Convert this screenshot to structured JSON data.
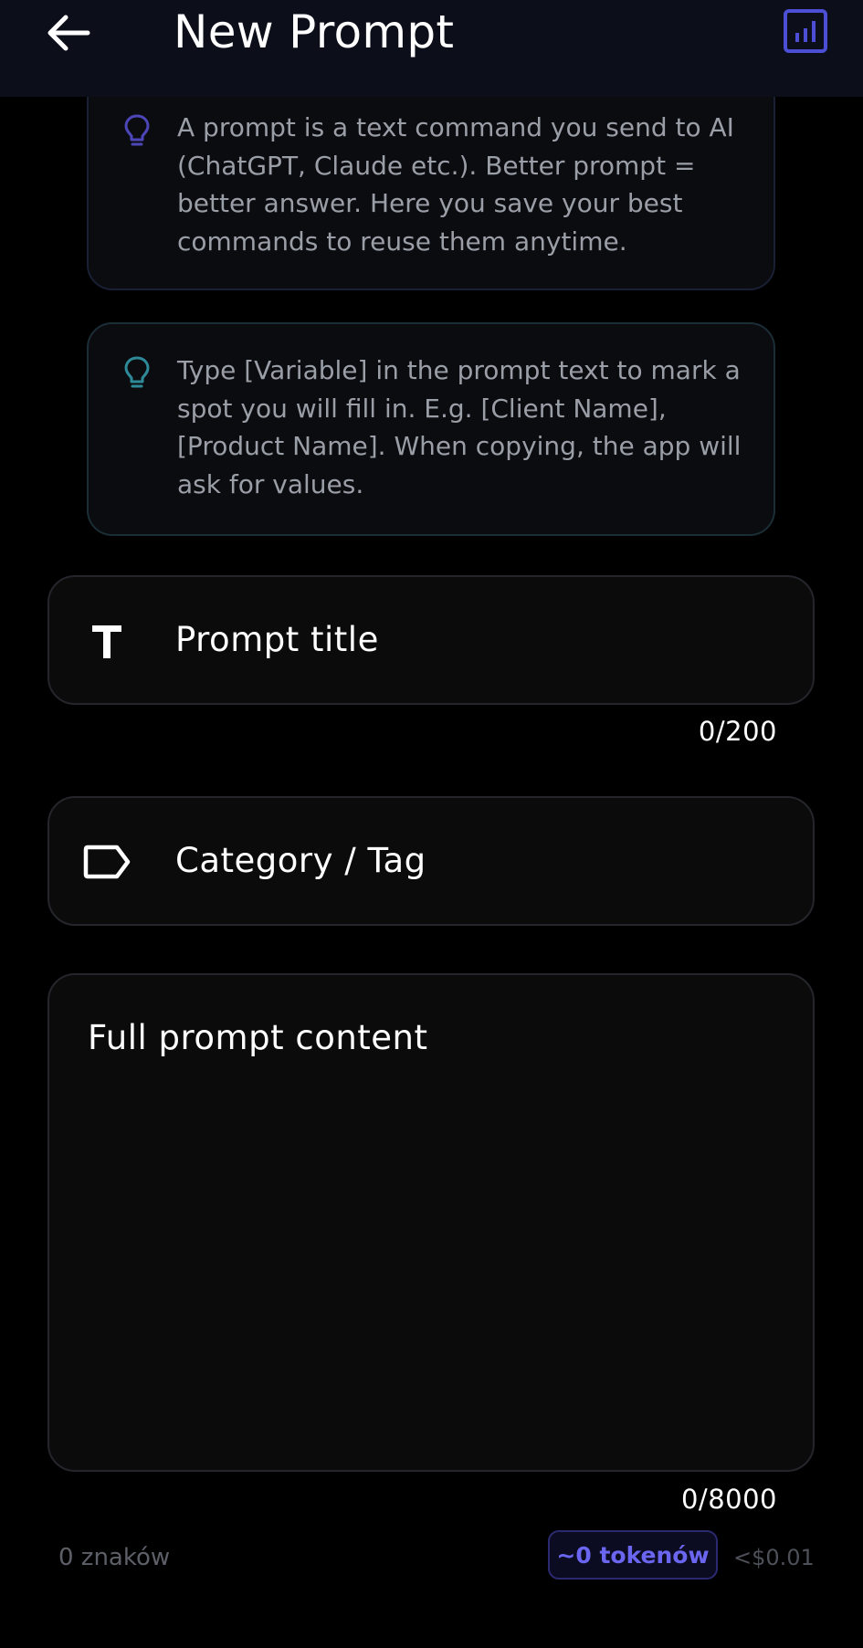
{
  "header": {
    "title": "New Prompt",
    "back_icon": "arrow-left-icon",
    "stats_icon": "bar-chart-icon",
    "accent_color": "#4c4fd6"
  },
  "info_cards": [
    {
      "icon": "lightbulb-icon",
      "icon_color": "#4d46b8",
      "text": "A prompt is a text command you send to AI (ChatGPT, Claude etc.). Better prompt = better answer. Here you save your best commands to reuse them anytime."
    },
    {
      "icon": "lightbulb-icon",
      "icon_color": "#2e8a98",
      "text": "Type [Variable] in the prompt text to mark a spot you will fill in. E.g. [Client Name], [Product Name]. When copying, the app will ask for values."
    }
  ],
  "form": {
    "title_field": {
      "icon": "text-t-icon",
      "placeholder": "Prompt title",
      "value": "",
      "counter": "0/200"
    },
    "category_field": {
      "icon": "tag-icon",
      "placeholder": "Category / Tag",
      "value": ""
    },
    "content_field": {
      "placeholder": "Full prompt content",
      "value": "",
      "counter": "0/8000"
    }
  },
  "stats": {
    "chars": "0 znaków",
    "tokens": "~0 tokenów",
    "cost": "<$0.01",
    "tokens_color": "#6b66f0"
  }
}
